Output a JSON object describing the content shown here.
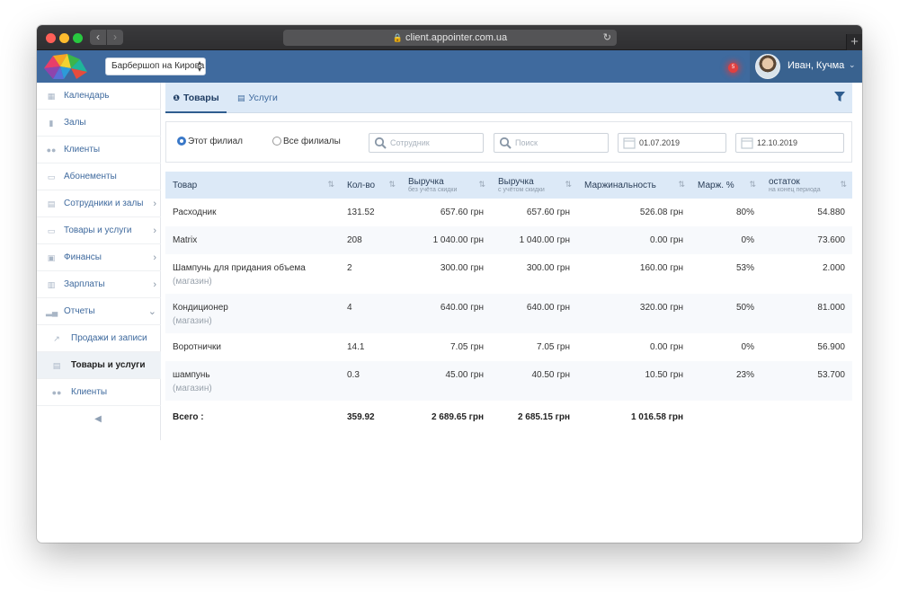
{
  "browser": {
    "url": "client.appointer.com.ua"
  },
  "header": {
    "branch_select": "Барбершоп на Кирова",
    "notification_count": "5",
    "user_name": "Иван, Кучма"
  },
  "sidebar": {
    "items": [
      {
        "label": "Календарь",
        "icon": "calendar-icon"
      },
      {
        "label": "Залы",
        "icon": "bookmark-icon"
      },
      {
        "label": "Клиенты",
        "icon": "users-icon"
      },
      {
        "label": "Абонементы",
        "icon": "card-icon"
      },
      {
        "label": "Сотрудники и залы",
        "icon": "id-card-icon"
      },
      {
        "label": "Товары и услуги",
        "icon": "card-icon"
      },
      {
        "label": "Финансы",
        "icon": "money-icon"
      },
      {
        "label": "Зарплаты",
        "icon": "wallet-icon"
      },
      {
        "label": "Отчеты",
        "icon": "bar-chart-icon"
      }
    ],
    "subitems": [
      {
        "label": "Продажи и записи",
        "icon": "line-chart-icon"
      },
      {
        "label": "Товары и услуги",
        "icon": "list-icon",
        "active": true
      },
      {
        "label": "Клиенты",
        "icon": "users-icon"
      }
    ]
  },
  "tabs": [
    {
      "label": "Товары",
      "icon": "info-icon"
    },
    {
      "label": "Услуги",
      "icon": "id-card-icon"
    }
  ],
  "filters": {
    "radio_this_branch": "Этот филиал",
    "radio_all_branches": "Все филиалы",
    "employee_placeholder": "Сотрудник",
    "search_placeholder": "Поиск",
    "date_from": "01.07.2019",
    "date_to": "12.10.2019"
  },
  "table": {
    "headers": [
      {
        "label": "Товар",
        "sub": ""
      },
      {
        "label": "Кол-во",
        "sub": ""
      },
      {
        "label": "Выручка",
        "sub": "без учёта скидки"
      },
      {
        "label": "Выручка",
        "sub": "с учётом скидки"
      },
      {
        "label": "Маржинальность",
        "sub": ""
      },
      {
        "label": "Марж. %",
        "sub": ""
      },
      {
        "label": "остаток",
        "sub": "на конец периода"
      }
    ],
    "rows": [
      {
        "name": "Расходник",
        "meta": "",
        "qty": "131.52",
        "rev": "657.60 грн",
        "rev_disc": "657.60 грн",
        "margin": "526.08 грн",
        "margin_pct": "80%",
        "stock": "54.880"
      },
      {
        "name": "Matrix",
        "meta": "",
        "qty": "208",
        "rev": "1 040.00 грн",
        "rev_disc": "1 040.00 грн",
        "margin": "0.00 грн",
        "margin_pct": "0%",
        "stock": "73.600"
      },
      {
        "name": "Шампунь для придания объема",
        "meta": "(магазин)",
        "qty": "2",
        "rev": "300.00 грн",
        "rev_disc": "300.00 грн",
        "margin": "160.00 грн",
        "margin_pct": "53%",
        "stock": "2.000"
      },
      {
        "name": "Кондиционер",
        "meta": "(магазин)",
        "qty": "4",
        "rev": "640.00 грн",
        "rev_disc": "640.00 грн",
        "margin": "320.00 грн",
        "margin_pct": "50%",
        "stock": "81.000"
      },
      {
        "name": "Воротнички",
        "meta": "",
        "qty": "14.1",
        "rev": "7.05 грн",
        "rev_disc": "7.05 грн",
        "margin": "0.00 грн",
        "margin_pct": "0%",
        "stock": "56.900"
      },
      {
        "name": "шампунь",
        "meta": "(магазин)",
        "qty": "0.3",
        "rev": "45.00 грн",
        "rev_disc": "40.50 грн",
        "margin": "10.50 грн",
        "margin_pct": "23%",
        "stock": "53.700"
      }
    ],
    "total": {
      "label": "Всего :",
      "qty": "359.92",
      "rev": "2 689.65 грн",
      "rev_disc": "2 685.15 грн",
      "margin": "1 016.58 грн"
    }
  },
  "colors": {
    "appbar": "#3f6a9e",
    "tab_bar": "#dce9f7",
    "accent": "#3a78c8",
    "notification": "#e04040"
  }
}
